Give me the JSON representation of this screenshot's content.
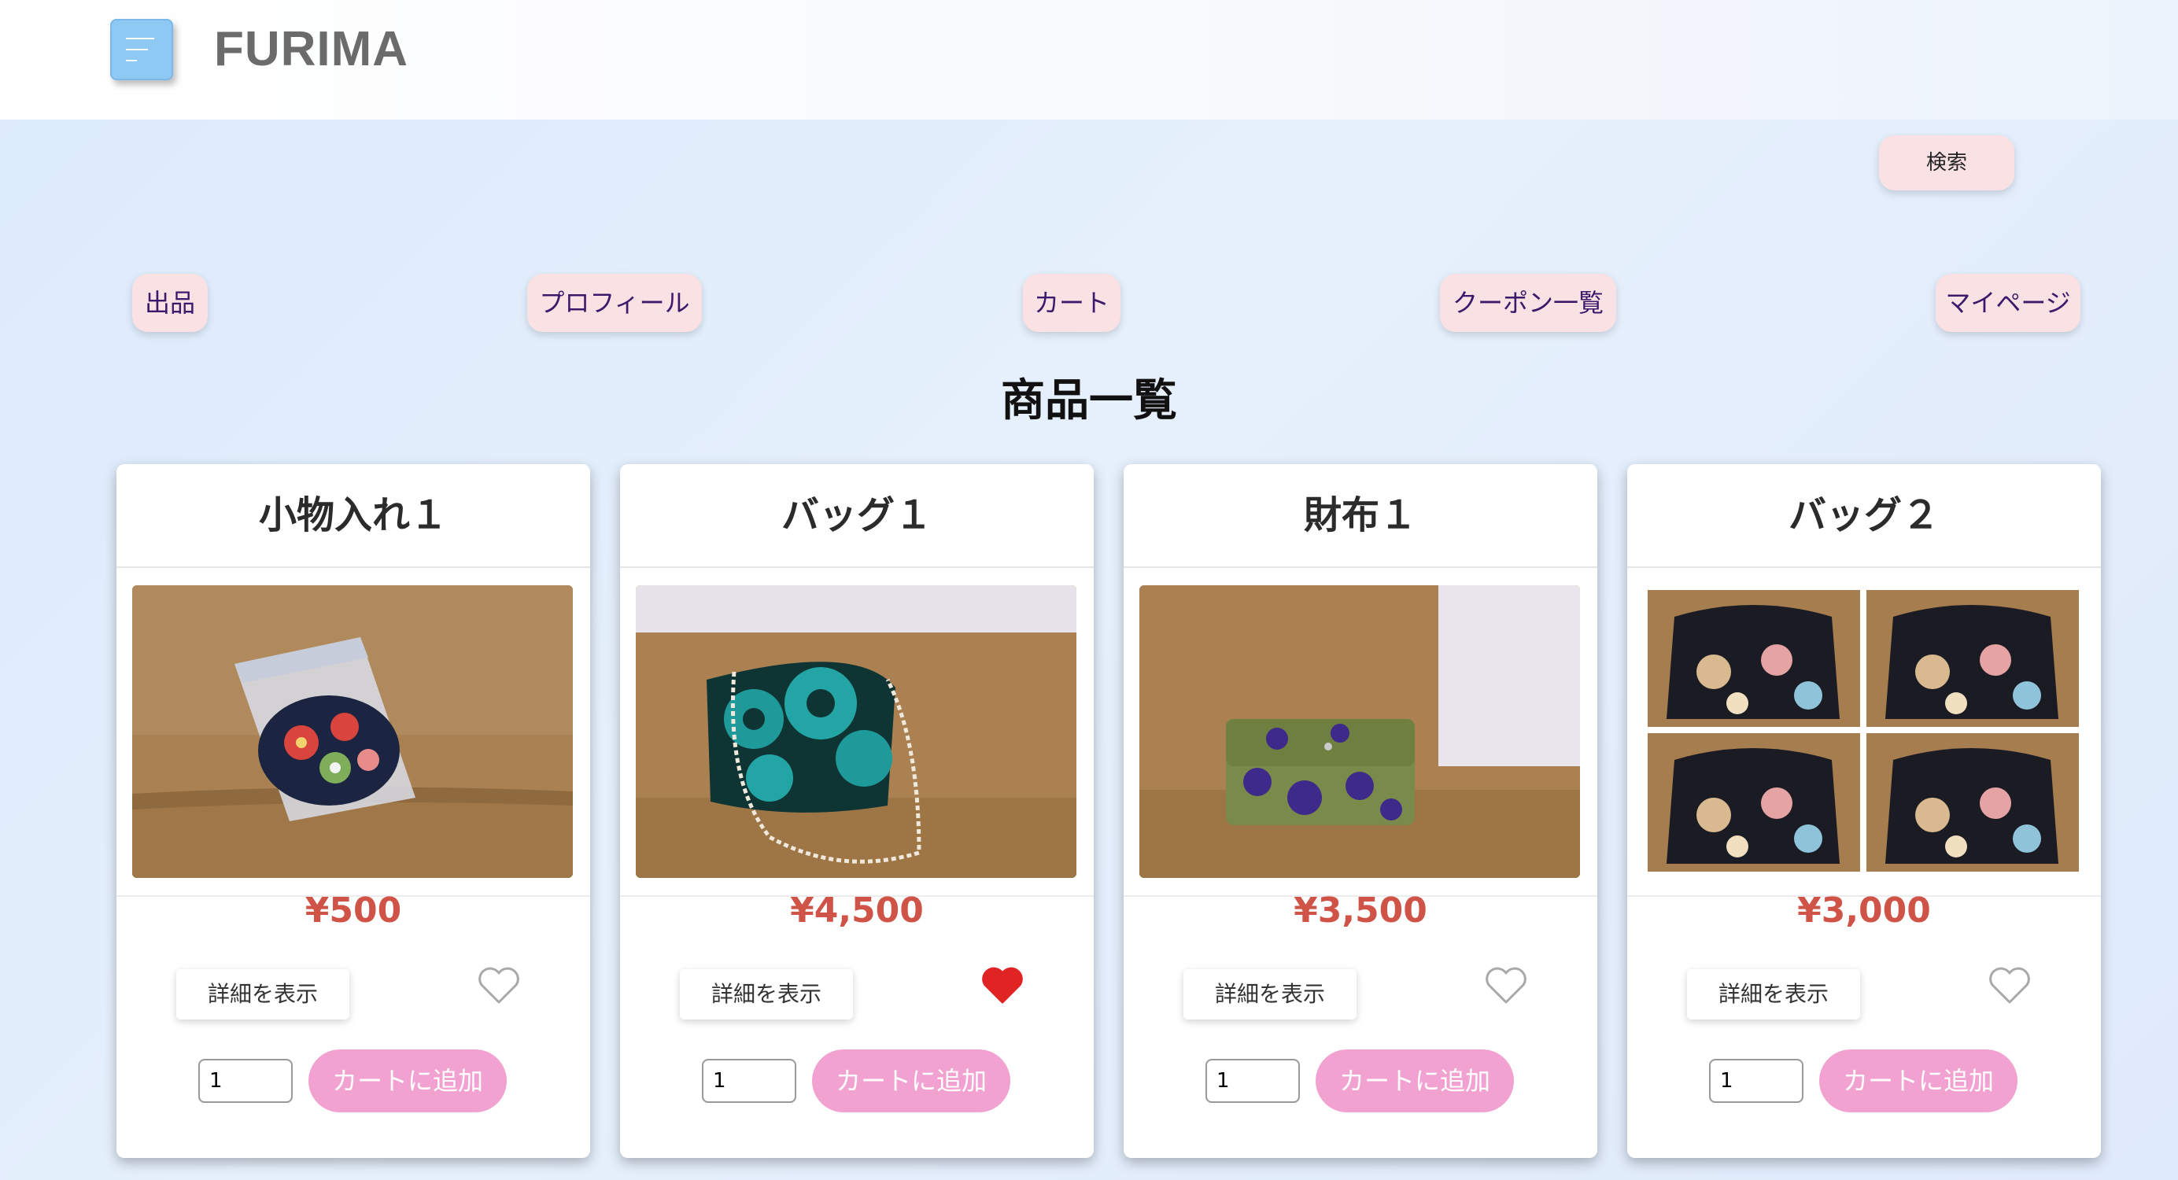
{
  "header": {
    "logo": "FURIMA"
  },
  "search": {
    "label": "検索"
  },
  "nav": [
    {
      "label": "出品"
    },
    {
      "label": "プロフィール"
    },
    {
      "label": "カート"
    },
    {
      "label": "クーポン一覧"
    },
    {
      "label": "マイページ"
    }
  ],
  "page": {
    "title": "商品一覧"
  },
  "products": [
    {
      "name": "小物入れ１",
      "price": "¥500",
      "detail": "詳細を表示",
      "favorited": false,
      "quantity": "1",
      "add_to_cart": "カートに追加"
    },
    {
      "name": "バッグ１",
      "price": "¥4,500",
      "detail": "詳細を表示",
      "favorited": true,
      "quantity": "1",
      "add_to_cart": "カートに追加"
    },
    {
      "name": "財布１",
      "price": "¥3,500",
      "detail": "詳細を表示",
      "favorited": false,
      "quantity": "1",
      "add_to_cart": "カートに追加"
    },
    {
      "name": "バッグ２",
      "price": "¥3,000",
      "detail": "詳細を表示",
      "favorited": false,
      "quantity": "1",
      "add_to_cart": "カートに追加"
    }
  ],
  "colors": {
    "accent_pink": "#f2a2d1",
    "price_red": "#d05348",
    "nav_pill": "#f9e1e4",
    "menu_blue": "#8ec9f4",
    "heart_red": "#e02424"
  }
}
